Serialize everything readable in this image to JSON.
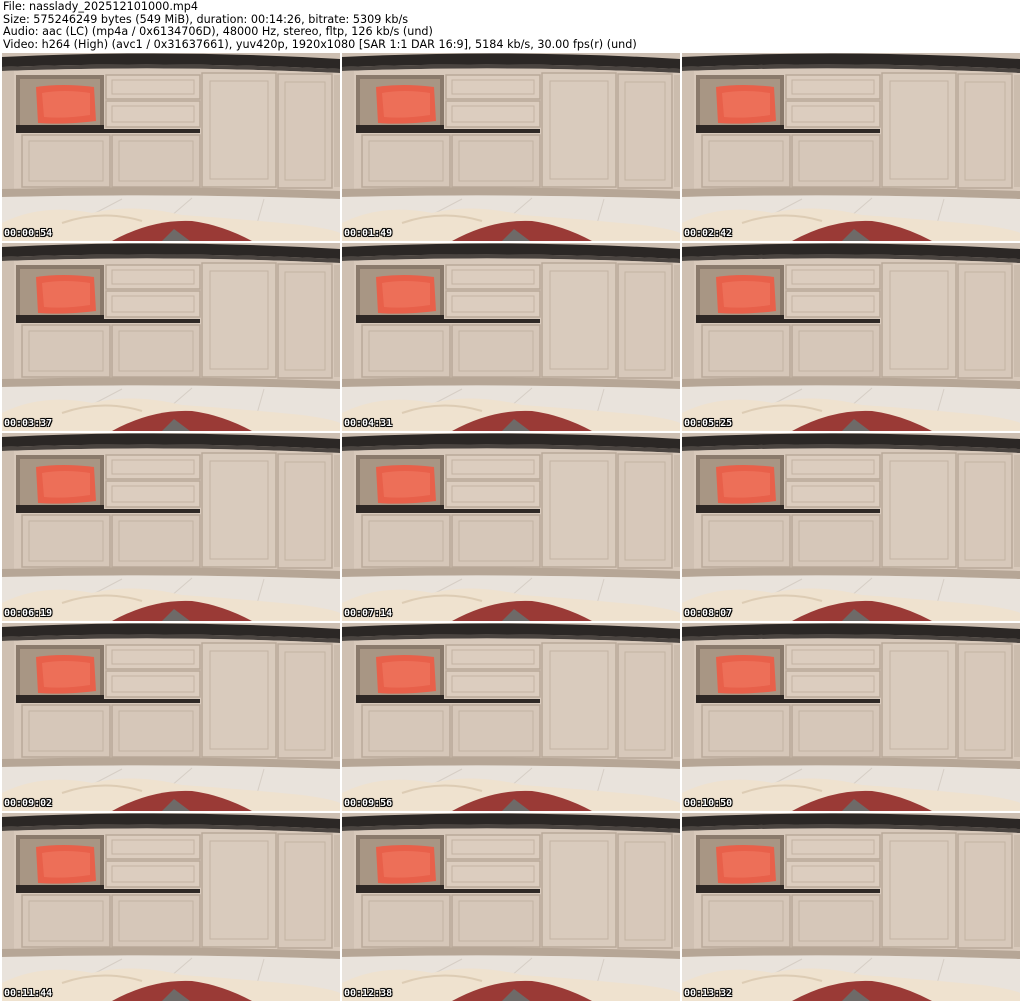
{
  "header": {
    "file": "File: nasslady_202512101000.mp4",
    "size": "Size: 575246249 bytes (549 MiB), duration: 00:14:26, bitrate: 5309 kb/s",
    "audio": "Audio: aac (LC) (mp4a / 0x6134706D), 48000 Hz, stereo, fltp, 126 kb/s (und)",
    "video": "Video: h264 (High) (avc1 / 0x31637661), yuv420p, 1920x1080 [SAR 1:1 DAR 16:9], 5184 kb/s, 30.00 fps(r) (und)"
  },
  "thumbnails": [
    {
      "timestamp": "00:00:54"
    },
    {
      "timestamp": "00:01:49"
    },
    {
      "timestamp": "00:02:42"
    },
    {
      "timestamp": "00:03:37"
    },
    {
      "timestamp": "00:04:31"
    },
    {
      "timestamp": "00:05:25"
    },
    {
      "timestamp": "00:06:19"
    },
    {
      "timestamp": "00:07:14"
    },
    {
      "timestamp": "00:08:07"
    },
    {
      "timestamp": "00:09:02"
    },
    {
      "timestamp": "00:09:56"
    },
    {
      "timestamp": "00:10:50"
    },
    {
      "timestamp": "00:11:44"
    },
    {
      "timestamp": "00:12:38"
    },
    {
      "timestamp": "00:13:32"
    }
  ],
  "colors": {
    "cabinet": "#d8c9bb",
    "cabinet_shadow": "#b9a999",
    "countertop": "#2b2725",
    "towel": "#e8604a",
    "floor": "#e9e3dc",
    "blanket": "#efe2cf",
    "red_fabric": "#9a3a36"
  }
}
